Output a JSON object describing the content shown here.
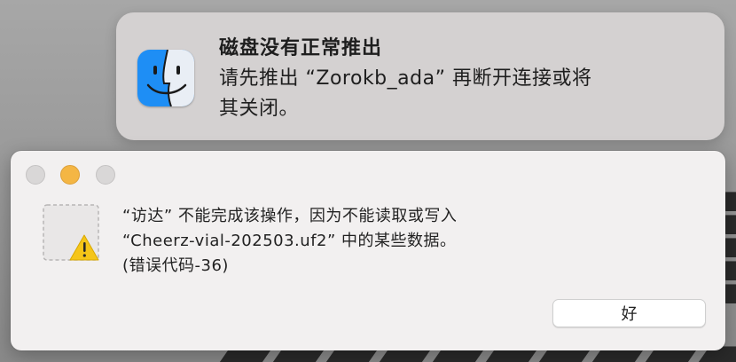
{
  "notification": {
    "app_icon": "finder-icon",
    "title": "磁盘没有正常推出",
    "body_line1": "请先推出 “Zorokb_ada” 再断开连接或将",
    "body_line2": "其关闭。"
  },
  "alert": {
    "window_controls": [
      "close",
      "minimize",
      "zoom"
    ],
    "icon": "document-warning-icon",
    "message_line1": "“访达” 不能完成该操作，因为不能读取或写入",
    "message_line2": "“Cheerz-vial-202503.uf2” 中的某些数据。",
    "message_line3": "(错误代码-36)",
    "ok_label": "好"
  },
  "colors": {
    "minimize": "#f4b644",
    "warning": "#f5c518",
    "finder_blue": "#1e8ef5"
  }
}
